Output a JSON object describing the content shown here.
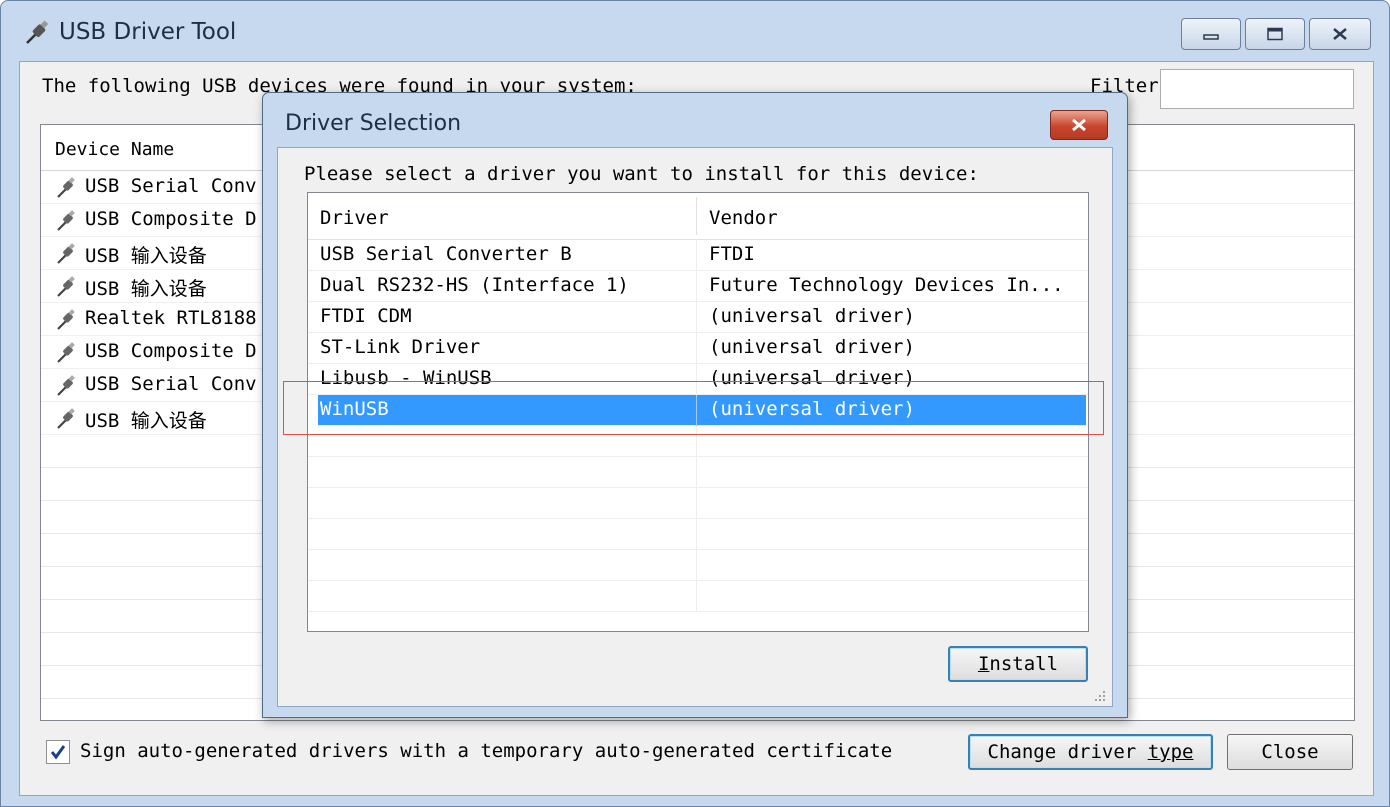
{
  "window": {
    "title": "USB Driver Tool",
    "found_label": "The following USB devices were found in your system:",
    "filter_label": "Filter",
    "filter_value": ""
  },
  "device_list": {
    "column": "Device Name",
    "rows": [
      "USB Serial Conv",
      "USB Composite D",
      "USB 输入设备",
      "USB 输入设备",
      "Realtek RTL8188",
      "USB Composite D",
      "USB Serial Conv",
      "USB 输入设备"
    ]
  },
  "footer": {
    "sign_label": "Sign auto-generated drivers with a temporary auto-generated certificate",
    "sign_checked": true,
    "change_prefix": "Change driver ",
    "change_accel": "type",
    "close_label": "Close"
  },
  "dialog": {
    "title": "Driver Selection",
    "prompt": "Please select a driver you want to install for this device:",
    "columns": [
      "Driver",
      "Vendor"
    ],
    "rows": [
      {
        "driver": "USB Serial Converter B",
        "vendor": "FTDI"
      },
      {
        "driver": "Dual RS232-HS (Interface 1)",
        "vendor": "Future Technology Devices In..."
      },
      {
        "driver": "FTDI CDM",
        "vendor": "(universal driver)"
      },
      {
        "driver": "ST-Link Driver",
        "vendor": "(universal driver)"
      },
      {
        "driver": "Libusb - WinUSB",
        "vendor": "(universal driver)"
      },
      {
        "driver": "WinUSB",
        "vendor": "(universal driver)",
        "selected": true
      }
    ],
    "install_accel": "I",
    "install_rest": "nstall"
  },
  "colors": {
    "selection": "#3399ff",
    "highlight_box": "#e05050",
    "window_frame": "#c6d9ee"
  },
  "icons": {
    "app": "usb-plug-icon",
    "device_row": "usb-plug-icon",
    "minimize": "minimize-icon",
    "maximize": "maximize-icon",
    "close": "close-icon"
  }
}
